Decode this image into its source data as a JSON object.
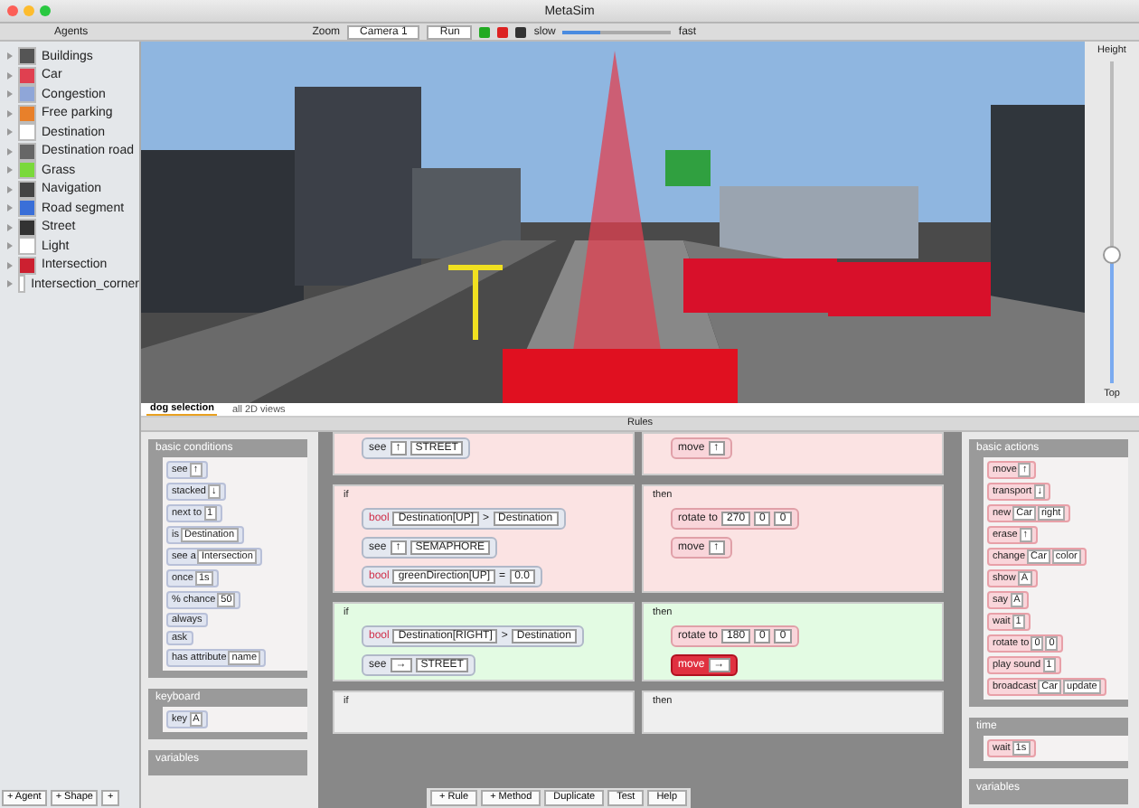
{
  "window": {
    "title": "MetaSim"
  },
  "toolbar": {
    "sidebar_label": "Agents",
    "zoom_label": "Zoom",
    "camera": "Camera 1",
    "mode": "Run",
    "speed_label": "slow",
    "speed": {
      "level": 0.35
    },
    "speed_end": "fast"
  },
  "agents": [
    {
      "name": "Buildings",
      "color": "#555555"
    },
    {
      "name": "Car",
      "color": "#e04050"
    },
    {
      "name": "Congestion",
      "color": "#8fa6d8"
    },
    {
      "name": "Free parking",
      "color": "#e8802a"
    },
    {
      "name": "Destination",
      "color": "#ffffff"
    },
    {
      "name": "Destination road",
      "color": "#666666"
    },
    {
      "name": "Grass",
      "color": "#7ad93a"
    },
    {
      "name": "Navigation",
      "color": "#444444"
    },
    {
      "name": "Road segment",
      "color": "#3a6fd8"
    },
    {
      "name": "Street",
      "color": "#333333"
    },
    {
      "name": "Light",
      "color": "#ffffff"
    },
    {
      "name": "Intersection",
      "color": "#cc2030"
    },
    {
      "name": "Intersection_corner",
      "color": "#ffffff"
    }
  ],
  "scene": {
    "top_label": "Height",
    "bottom_label": "Top",
    "height": {
      "level": 0.4
    }
  },
  "view_tabs": [
    {
      "label": "dog selection",
      "selected": true
    },
    {
      "label": "all 2D views",
      "selected": false
    }
  ],
  "rules_title": "Rules",
  "left_palette": [
    {
      "title": "basic conditions",
      "blocks": [
        [
          "see",
          "↑"
        ],
        [
          "stacked",
          "↓"
        ],
        [
          "next to",
          "1"
        ],
        [
          "is",
          "Destination"
        ],
        [
          "see a",
          "Intersection"
        ],
        [
          "once",
          "1s"
        ],
        [
          "% chance",
          "50"
        ],
        [
          "always"
        ],
        [
          "ask"
        ],
        [
          "has attribute",
          "name"
        ]
      ]
    },
    {
      "title": "keyboard",
      "blocks": [
        [
          "key",
          "A"
        ]
      ]
    },
    {
      "title": "variables"
    }
  ],
  "rules": [
    {
      "color": "#fbe3e3",
      "conditions": [
        [
          {
            "kind": "label",
            "text": "see"
          },
          {
            "kind": "field",
            "text": "↑"
          },
          {
            "kind": "field",
            "text": "STREET"
          }
        ]
      ],
      "actions": [
        {
          "active": false,
          "parts": [
            {
              "kind": "label",
              "text": "move"
            },
            {
              "kind": "field",
              "text": "↑"
            }
          ]
        }
      ]
    },
    {
      "color": "#fbe3e3",
      "if_label": "if",
      "then_label": "then",
      "conditions": [
        [
          {
            "kind": "key",
            "text": "bool"
          },
          {
            "kind": "field",
            "text": "Destination[UP]"
          },
          {
            "kind": "label",
            "text": ">"
          },
          {
            "kind": "field",
            "text": "Destination"
          }
        ],
        [
          {
            "kind": "label",
            "text": "see"
          },
          {
            "kind": "field",
            "text": "↑"
          },
          {
            "kind": "field",
            "text": "SEMAPHORE"
          }
        ],
        [
          {
            "kind": "key",
            "text": "bool"
          },
          {
            "kind": "field",
            "text": "greenDirection[UP]"
          },
          {
            "kind": "label",
            "text": "="
          },
          {
            "kind": "field",
            "text": "0.0"
          }
        ]
      ],
      "actions": [
        {
          "active": false,
          "parts": [
            {
              "kind": "label",
              "text": "rotate to"
            },
            {
              "kind": "field",
              "text": "270"
            },
            {
              "kind": "field",
              "text": "0"
            },
            {
              "kind": "field",
              "text": "0"
            }
          ]
        },
        {
          "active": false,
          "parts": [
            {
              "kind": "label",
              "text": "move"
            },
            {
              "kind": "field",
              "text": "↑"
            }
          ]
        }
      ]
    },
    {
      "color": "#e3fbe3",
      "if_label": "if",
      "then_label": "then",
      "conditions": [
        [
          {
            "kind": "key",
            "text": "bool"
          },
          {
            "kind": "field",
            "text": "Destination[RIGHT]"
          },
          {
            "kind": "label",
            "text": ">"
          },
          {
            "kind": "field",
            "text": "Destination"
          }
        ],
        [
          {
            "kind": "label",
            "text": "see"
          },
          {
            "kind": "field",
            "text": "→"
          },
          {
            "kind": "field",
            "text": "STREET"
          }
        ]
      ],
      "actions": [
        {
          "active": false,
          "parts": [
            {
              "kind": "label",
              "text": "rotate to"
            },
            {
              "kind": "field",
              "text": "180"
            },
            {
              "kind": "field",
              "text": "0"
            },
            {
              "kind": "field",
              "text": "0"
            }
          ]
        },
        {
          "active": true,
          "parts": [
            {
              "kind": "label",
              "text": "move"
            },
            {
              "kind": "field",
              "text": "→"
            }
          ]
        }
      ]
    },
    {
      "color": "#efefef",
      "if_label": "if",
      "then_label": "then"
    }
  ],
  "right_palette": [
    {
      "title": "basic actions",
      "blocks": [
        [
          "move",
          "↑"
        ],
        [
          "transport",
          "↓"
        ],
        [
          "new",
          "Car",
          "right"
        ],
        [
          "erase",
          "↑"
        ],
        [
          "change",
          "Car",
          "color"
        ],
        [
          "show",
          "A"
        ],
        [
          "say",
          "A"
        ],
        [
          "wait",
          "1"
        ],
        [
          "rotate to",
          "0",
          "0"
        ],
        [
          "play sound",
          "1"
        ],
        [
          "broadcast",
          "Car",
          "update"
        ]
      ]
    },
    {
      "title": "time",
      "blocks": [
        [
          "wait",
          "1s"
        ]
      ]
    },
    {
      "title": "variables"
    }
  ],
  "bottom_left": [
    "+ Agent",
    "+ Shape",
    "+"
  ],
  "bottom_buttons": [
    "+ Rule",
    "+ Method",
    "Duplicate",
    "Test",
    "Help"
  ]
}
